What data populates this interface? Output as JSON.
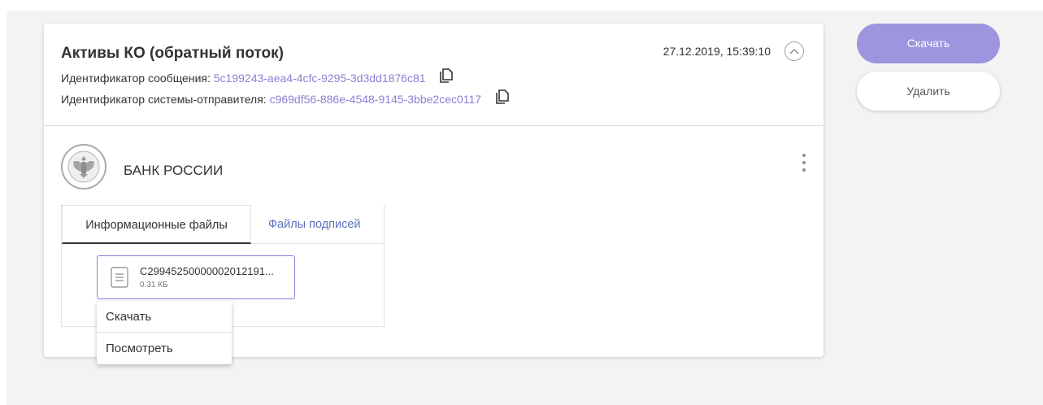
{
  "card": {
    "title": "Активы КО (обратный поток)",
    "timestamp": "27.12.2019, 15:39:10",
    "message_id_label": "Идентификатор сообщения: ",
    "message_id_value": "5c199243-aea4-4cfc-9295-3d3dd1876c81",
    "sender_id_label": "Идентификатор системы-отправителя: ",
    "sender_id_value": "c969df56-886e-4548-9145-3bbe2cec0117"
  },
  "org": {
    "name": "БАНК РОССИИ",
    "logo_icon": "bank-of-russia-emblem-icon"
  },
  "tabs": [
    {
      "label": "Информационные файлы",
      "active": true
    },
    {
      "label": "Файлы подписей",
      "active": false
    }
  ],
  "file": {
    "name": "C29945250000002012191...",
    "size": "0.31 КБ",
    "icon": "document-icon"
  },
  "context_menu": {
    "items": [
      "Скачать",
      "Посмотреть"
    ]
  },
  "actions": {
    "download_label": "Скачать",
    "delete_label": "Удалить"
  },
  "colors": {
    "accent": "#9d95dd",
    "link": "#8a7fd6",
    "tab_link": "#5b6fbf",
    "background": "#f3f3f3"
  }
}
